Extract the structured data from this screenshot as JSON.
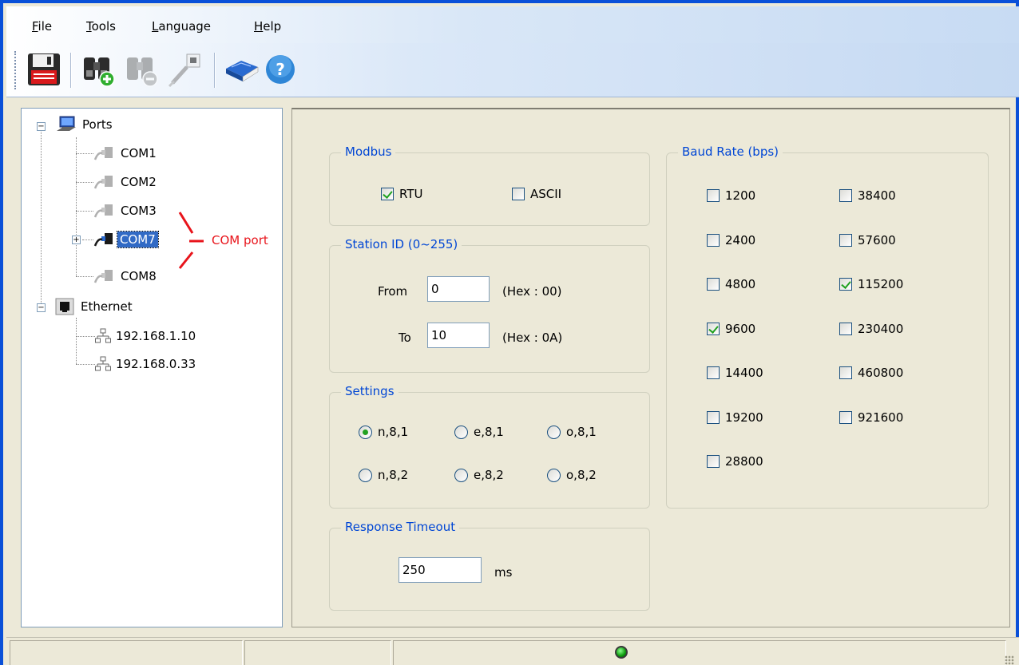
{
  "menu": {
    "file": {
      "accel": "F",
      "rest": "ile"
    },
    "tools": {
      "accel": "T",
      "rest": "ools"
    },
    "language": {
      "accel": "L",
      "rest": "anguage"
    },
    "help": {
      "accel": "H",
      "rest": "elp"
    }
  },
  "toolbar": {
    "buttons": [
      "save-icon",
      "add-device-icon",
      "remove-device-icon",
      "connect-icon",
      "manual-icon",
      "about-icon"
    ]
  },
  "tree": {
    "ports": {
      "label": "Ports",
      "items": [
        "COM1",
        "COM2",
        "COM3",
        "COM7",
        "COM8"
      ],
      "selected": "COM7"
    },
    "ethernet": {
      "label": "Ethernet",
      "items": [
        "192.168.1.10",
        "192.168.0.33"
      ]
    },
    "annotation": "COM port",
    "annotation_color": "#e8141b"
  },
  "modbus": {
    "legend": "Modbus",
    "rtu": {
      "label": "RTU",
      "checked": true
    },
    "ascii": {
      "label": "ASCII",
      "checked": false
    }
  },
  "station": {
    "legend": "Station ID (0~255)",
    "from_label": "From",
    "from_value": "0",
    "from_hex": "(Hex : 00)",
    "to_label": "To",
    "to_value": "10",
    "to_hex": "(Hex : 0A)"
  },
  "settings": {
    "legend": "Settings",
    "options": [
      {
        "label": "n,8,1",
        "checked": true
      },
      {
        "label": "e,8,1",
        "checked": false
      },
      {
        "label": "o,8,1",
        "checked": false
      },
      {
        "label": "n,8,2",
        "checked": false
      },
      {
        "label": "e,8,2",
        "checked": false
      },
      {
        "label": "o,8,2",
        "checked": false
      }
    ]
  },
  "timeout": {
    "legend": "Response Timeout",
    "value": "250",
    "unit": "ms"
  },
  "baud": {
    "legend": "Baud Rate (bps)",
    "rates": [
      {
        "label": "1200",
        "checked": false
      },
      {
        "label": "38400",
        "checked": false
      },
      {
        "label": "2400",
        "checked": false
      },
      {
        "label": "57600",
        "checked": false
      },
      {
        "label": "4800",
        "checked": false
      },
      {
        "label": "115200",
        "checked": true
      },
      {
        "label": "9600",
        "checked": true
      },
      {
        "label": "230400",
        "checked": false
      },
      {
        "label": "14400",
        "checked": false
      },
      {
        "label": "460800",
        "checked": false
      },
      {
        "label": "19200",
        "checked": false
      },
      {
        "label": "921600",
        "checked": false
      },
      {
        "label": "28800",
        "checked": false
      }
    ]
  },
  "status": {
    "connection_led": "green"
  },
  "colors": {
    "title_blue": "#0a50d8",
    "legend_blue": "#0046d5",
    "selection": "#316ac5",
    "check_green": "#21a121"
  }
}
